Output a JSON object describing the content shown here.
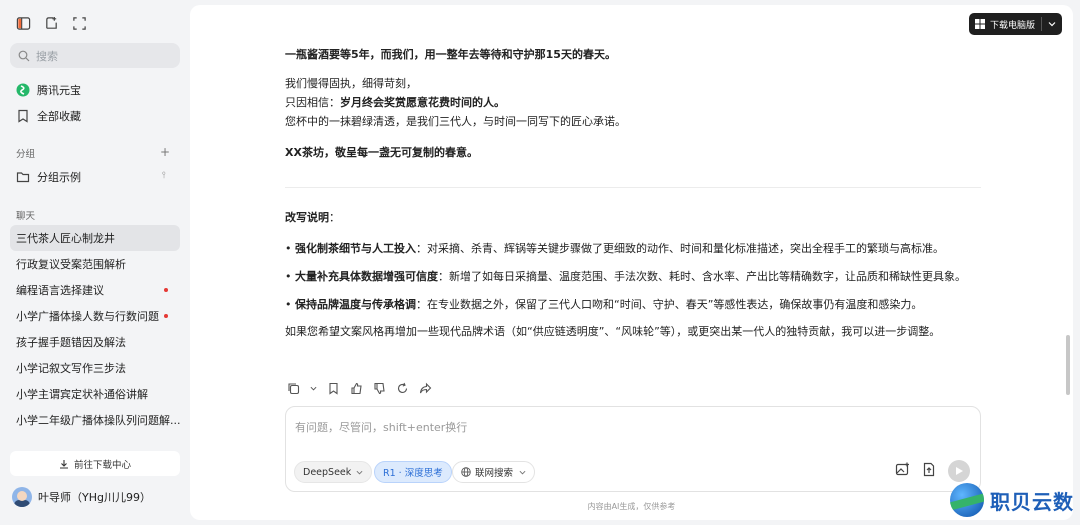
{
  "sidebar": {
    "search_placeholder": "搜索",
    "nav": [
      {
        "label": "腾讯元宝"
      },
      {
        "label": "全部收藏"
      }
    ],
    "group_section_label": "分组",
    "group_item_label": "分组示例",
    "chat_section_label": "聊天",
    "chats": [
      {
        "label": "三代茶人匠心制龙井",
        "active": true,
        "unread": false
      },
      {
        "label": "行政复议受案范围解析",
        "active": false,
        "unread": false
      },
      {
        "label": "编程语言选择建议",
        "active": false,
        "unread": true
      },
      {
        "label": "小学广播体操人数与行数问题",
        "active": false,
        "unread": true
      },
      {
        "label": "孩子握手题错因及解法",
        "active": false,
        "unread": false
      },
      {
        "label": "小学记叙文写作三步法",
        "active": false,
        "unread": false
      },
      {
        "label": "小学主谓宾定状补通俗讲解",
        "active": false,
        "unread": false
      },
      {
        "label": "小学二年级广播体操队列问题解...",
        "active": false,
        "unread": false
      }
    ],
    "download_center_label": "前往下载中心",
    "user_name": "叶导师（YHg川儿99）"
  },
  "header": {
    "download_btn_label": "下载电脑版"
  },
  "message": {
    "line1": "一瓶酱酒要等5年，而我们，用一整年去等待和守护那15天的春天。",
    "line2": "我们慢得固执，细得苛刻，",
    "line3_prefix": "只因相信：",
    "line3_bold": "岁月终会奖赏愿意花费时间的人。",
    "line4": "您杯中的一抹碧绿清透，是我们三代人，与时间一同写下的匠心承诺。",
    "line5": "XX茶坊，敬呈每一盏无可复制的春意。",
    "notes_title": "改写说明",
    "notes_colon": "：",
    "bullets": [
      {
        "title": "强化制茶细节与人工投入",
        "text": "：对采摘、杀青、辉锅等关键步骤做了更细致的动作、时间和量化标准描述，突出全程手工的繁琐与高标准。"
      },
      {
        "title": "大量补充具体数据增强可信度",
        "text": "：新增了如每日采摘量、温度范围、手法次数、耗时、含水率、产出比等精确数字，让品质和稀缺性更具象。"
      },
      {
        "title": "保持品牌温度与传承格调",
        "text": "：在专业数据之外，保留了三代人口吻和“时间、守护、春天”等感性表达，确保故事仍有温度和感染力。"
      }
    ],
    "closing": "如果您希望文案风格再增加一些现代品牌术语（如“供应链透明度”、“风味轮”等），或更突出某一代人的独特贡献，我可以进一步调整。"
  },
  "input": {
    "placeholder": "有问题，尽管问，shift+enter换行",
    "model_label": "DeepSeek",
    "r1_label": "R1 · 深度思考",
    "web_label": "联网搜索"
  },
  "disclaimer": "内容由AI生成，仅供参考",
  "watermark": {
    "text": "职贝云数"
  },
  "colors": {
    "accent": "#2c6fd6",
    "dark_button": "#1f1f1f",
    "unread_dot": "#e53935"
  }
}
